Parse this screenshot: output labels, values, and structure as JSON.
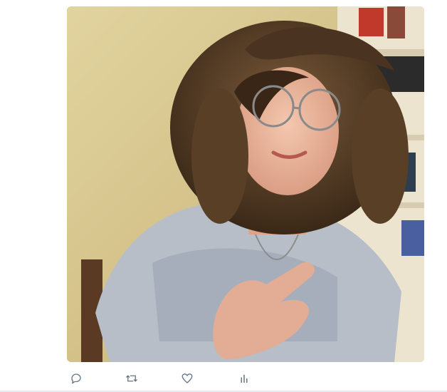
{
  "tweet": {
    "media": {
      "alt": "",
      "colors": {
        "wall": "#dccb8f",
        "wall_shadow": "#bfa86a",
        "hat_fur": "#6b4a2e",
        "hat_fur_dark": "#3d2a1a",
        "skin": "#e8b59c",
        "shirt": "#b9c0c8",
        "shirt_dark": "#8e97a4",
        "shelf": "#e8e0cc"
      }
    },
    "actions": [
      {
        "name": "reply",
        "icon": "reply-icon"
      },
      {
        "name": "retweet",
        "icon": "retweet-icon"
      },
      {
        "name": "like",
        "icon": "heart-icon"
      },
      {
        "name": "analytics",
        "icon": "analytics-icon"
      }
    ]
  }
}
